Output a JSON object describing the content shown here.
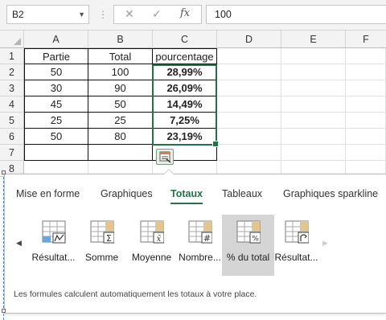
{
  "formula_bar": {
    "name_box": "B2",
    "cancel_glyph": "✕",
    "enter_glyph": "✓",
    "fx_label": "fx",
    "value": "100"
  },
  "columns": [
    "A",
    "B",
    "C",
    "D",
    "E",
    "F"
  ],
  "rows": [
    "1",
    "2",
    "3",
    "4",
    "5",
    "6",
    "7",
    "8"
  ],
  "table": {
    "headers": [
      "Partie",
      "Total",
      "pourcentage"
    ],
    "rows": [
      [
        "50",
        "100",
        "28,99%"
      ],
      [
        "30",
        "90",
        "26,09%"
      ],
      [
        "45",
        "50",
        "14,49%"
      ],
      [
        "25",
        "25",
        "7,25%"
      ],
      [
        "50",
        "80",
        "23,19%"
      ]
    ]
  },
  "quick_analysis": {
    "tabs": [
      "Mise en forme",
      "Graphiques",
      "Totaux",
      "Tableaux",
      "Graphiques sparkline"
    ],
    "active_tab": "Totaux",
    "options": [
      {
        "label": "Résultat...",
        "icon": "running-total-row-icon"
      },
      {
        "label": "Somme",
        "icon": "sum-column-icon"
      },
      {
        "label": "Moyenne",
        "icon": "average-column-icon"
      },
      {
        "label": "Nombre...",
        "icon": "count-column-icon"
      },
      {
        "label": "% du total",
        "icon": "percent-total-column-icon"
      },
      {
        "label": "Résultat...",
        "icon": "running-total-column-icon"
      }
    ],
    "selected_option": "% du total",
    "hint": "Les formules calculent automatiquement les totaux à votre place."
  },
  "colors": {
    "accent": "#217346",
    "selected_option_bg": "#d5d5d5",
    "icon_highlight": "#e2c58f"
  }
}
